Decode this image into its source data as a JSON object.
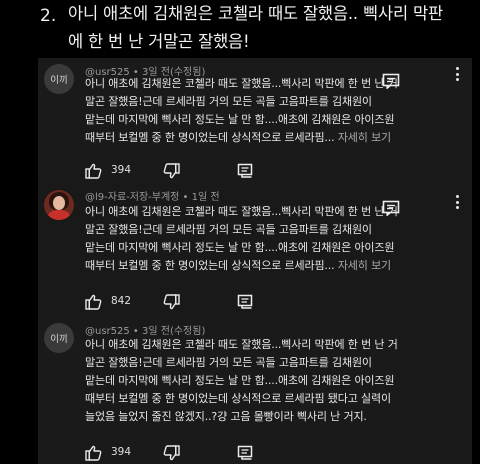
{
  "header": {
    "number": "2.",
    "title_line1": "아니 애초에 김채원은 코첼라 때도 잘했음.. 삑사리 막판",
    "title_line2": "에 한 번 난 거말곤 잘했음!"
  },
  "comments": [
    {
      "avatar_text": "이끼",
      "meta": "@usr525 • 3일 전(수정됨)",
      "lines": [
        "아니 애초에 김채원은 코첼라 때도 잘했음...삑사리 막판에 한 번 난 거",
        "말곤 잘했음!근데 르세라핌 거의 모든 곡들 고음파트를 김채원이",
        "맡는데 마지막에 삑사리 정도는 날 만 함....애초에 김채원은 아이즈원",
        "때부터 보컬멤 중 한 명이었는데 상식적으로 르세라핌..."
      ],
      "more": "자세히 보기",
      "likes": "394"
    },
    {
      "avatar_text": "",
      "meta": "@l9-자료-저장-부계정 • 1일 전",
      "lines": [
        "아니 애초에 김채원은 코첼라 때도 잘했음...삑사리 막판에 한 번 난 거",
        "말곤 잘했음!근데 르세라핌 거의 모든 곡들 고음파트를 김채원이",
        "맡는데 마지막에 삑사리 정도는 날 만 함....애초에 김채원은 아이즈원",
        "때부터 보컬멤 중 한 명이었는데 상식적으로 르세라핌..."
      ],
      "more": "자세히 보기",
      "likes": "842"
    },
    {
      "avatar_text": "이끼",
      "meta": "@usr525 • 3일 전(수정됨)",
      "lines": [
        "아니 애초에 김채원은 코첼라 때도 잘했음...삑사리 막판에 한 번 난 거",
        "말곤 잘했음!근데 르세라핌 거의 모든 곡들 고음파트를 김채원이",
        "맡는데 마지막에 삑사리 정도는 날 만 함....애초에 김채원은 아이즈원",
        "때부터 보컬멤 중 한 명이었는데 상식적으로 르세라핌 됐다고 실력이",
        "늘었음 늘었지 줄진 않겠지..?걍 고음 몰빵이라 삑사리 난 거지."
      ],
      "more": "",
      "likes": "394"
    }
  ],
  "icons": {
    "like": "thumbs-up-icon",
    "dislike": "thumbs-down-icon",
    "reply": "reply-icon",
    "more": "more-vertical-icon"
  },
  "colors": {
    "background": "#000000",
    "card": "#1a1a1a",
    "text": "#e8e8e8",
    "meta": "#9a9a9a"
  }
}
